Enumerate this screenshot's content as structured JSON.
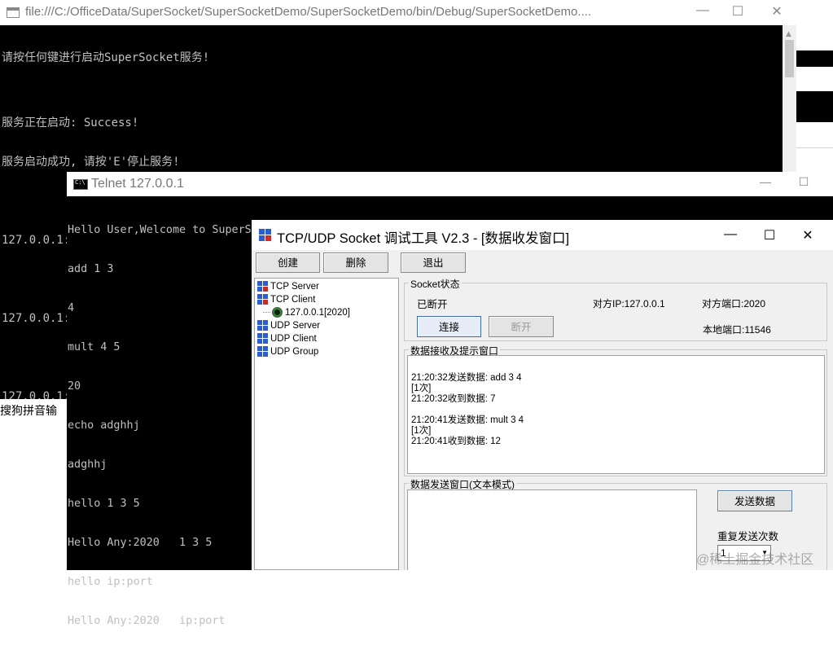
{
  "console": {
    "title": "file:///C:/OfficeData/SuperSocket/SuperSocketDemo/SuperSocketDemo/bin/Debug/SuperSocketDemo....",
    "lines": [
      "请按任何键进行启动SuperSocket服务!",
      "",
      "服务正在启动: Success!",
      "服务启动成功, 请按'E'停止服务!",
      "",
      "127.0.0.1:连接127.0.0.1",
      "",
      "127.0.0.1:连接127.0.0.1",
      "",
      "127.0.0.1:断开连接"
    ]
  },
  "ime": {
    "text": "搜狗拼音输"
  },
  "telnet": {
    "title": "Telnet 127.0.0.1",
    "lines": [
      "Hello User,Welcome to SuperSocket Telnet Server!",
      "add 1 3",
      "4",
      "mult 4 5",
      "20",
      "echo adghhj",
      "adghhj",
      "hello 1 3 5",
      "Hello Any:2020   1 3 5",
      "hello ip:port",
      "Hello Any:2020   ip:port"
    ]
  },
  "tool": {
    "title": "TCP/UDP Socket 调试工具 V2.3 - [数据收发窗口]",
    "toolbar": {
      "create": "创建",
      "delete": "删除",
      "exit": "退出"
    },
    "tree": [
      {
        "label": "TCP Server"
      },
      {
        "label": "TCP Client"
      },
      {
        "label": "127.0.0.1[2020]"
      },
      {
        "label": "UDP Server"
      },
      {
        "label": "UDP Client"
      },
      {
        "label": "UDP Group"
      }
    ],
    "socket": {
      "group_title": "Socket状态",
      "status": "已断开",
      "remote_ip": "对方IP:127.0.0.1",
      "remote_port": "对方端口:2020",
      "local_port": "本地端口:11546",
      "connect": "连接",
      "disconnect": "断开"
    },
    "recv": {
      "group_title": "数据接收及提示窗口",
      "lines": [
        "21:20:32发送数据: add 3 4",
        "[1次]",
        "21:20:32收到数据: 7",
        "",
        "21:20:41发送数据: mult 3 4",
        "[1次]",
        "21:20:41收到数据: 12"
      ]
    },
    "send": {
      "group_title": "数据发送窗口(文本模式)",
      "send_button": "发送数据",
      "repeat_label": "重复发送次数",
      "repeat_value": "1"
    }
  },
  "watermark": "@稀土掘金技术社区",
  "colors": {
    "console_bg": "#000000",
    "console_text": "#c0c0c0",
    "tool_bg": "#f0f0f0",
    "button_focus": "#3f6db5"
  }
}
